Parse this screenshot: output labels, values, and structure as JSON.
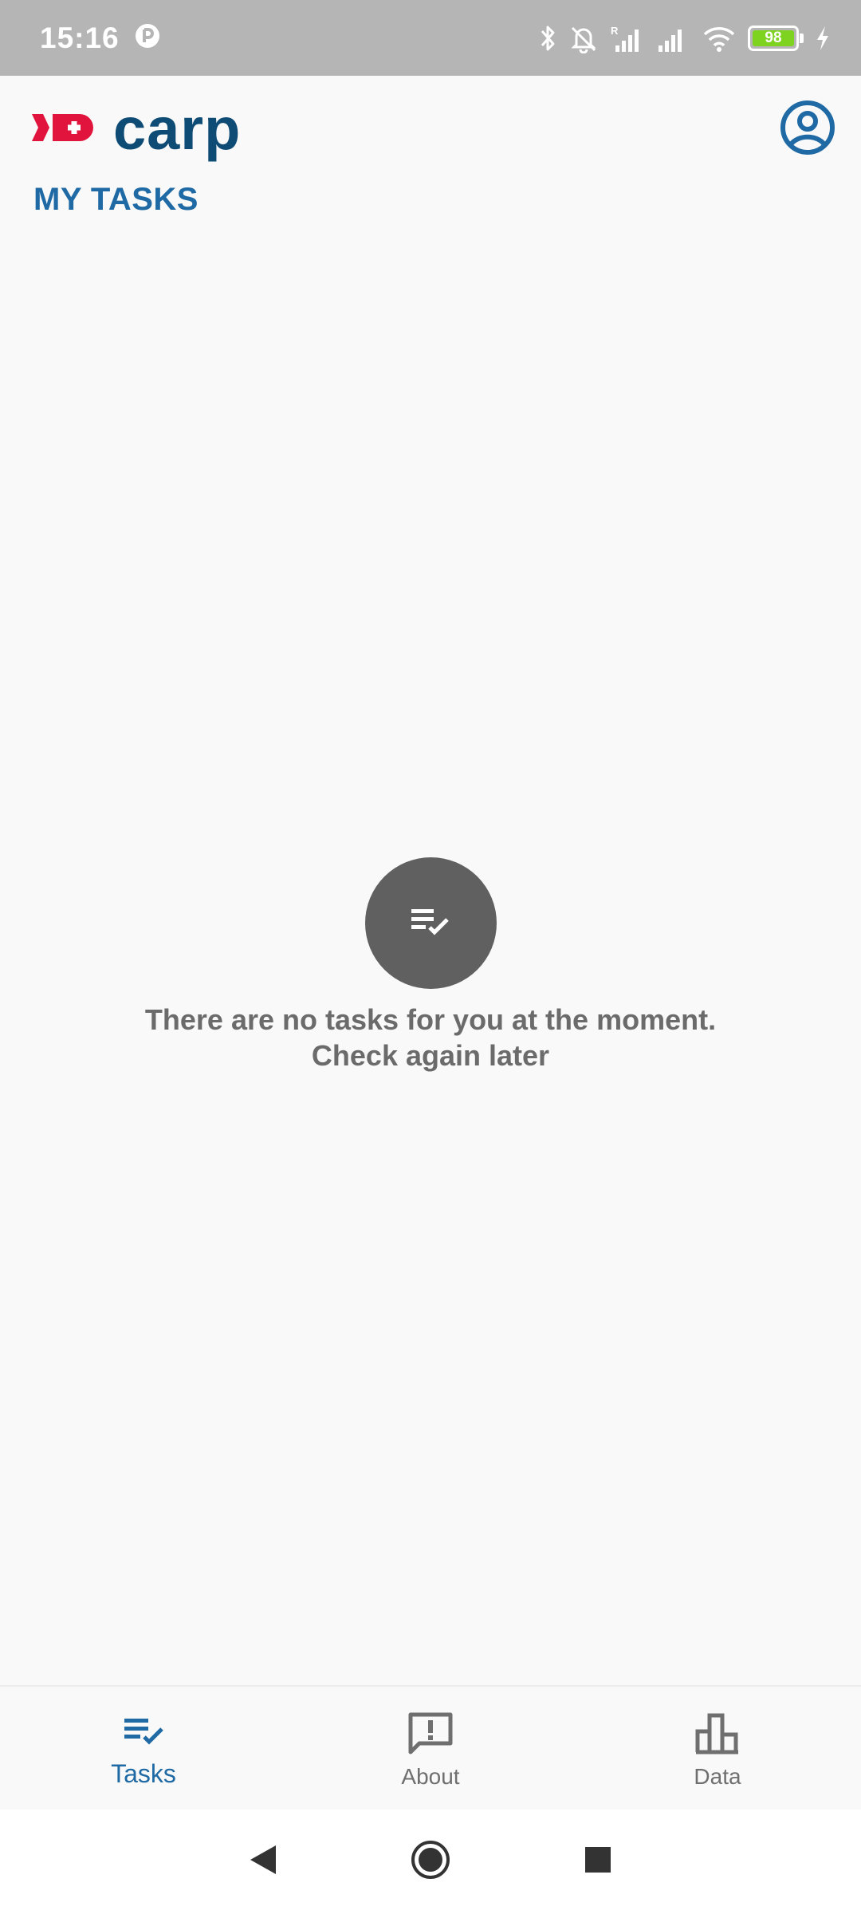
{
  "status_bar": {
    "time": "15:16",
    "battery_level": "98",
    "icons": [
      "app-notification-icon",
      "bluetooth-icon",
      "bell-off-icon",
      "signal-roaming-icon",
      "signal-icon",
      "wifi-icon",
      "battery-icon",
      "charging-icon"
    ]
  },
  "header": {
    "logo_text": "carp",
    "page_title": "MY TASKS",
    "profile_icon": "account-circle-icon"
  },
  "empty_state": {
    "icon": "task-list-check-icon",
    "message_line1": "There are no tasks for you at the moment.",
    "message_line2": "Check again later"
  },
  "bottom_nav": {
    "items": [
      {
        "label": "Tasks",
        "icon": "task-list-check-icon",
        "active": true
      },
      {
        "label": "About",
        "icon": "feedback-icon",
        "active": false
      },
      {
        "label": "Data",
        "icon": "bar-chart-icon",
        "active": false
      }
    ]
  },
  "system_nav": {
    "buttons": [
      "back-icon",
      "home-icon",
      "recents-icon"
    ]
  },
  "colors": {
    "brand_blue": "#0f4c75",
    "accent_blue": "#1f6aa5",
    "brand_red": "#e0143c",
    "status_bar_bg": "#b5b5b5",
    "battery_green": "#7ed321"
  }
}
